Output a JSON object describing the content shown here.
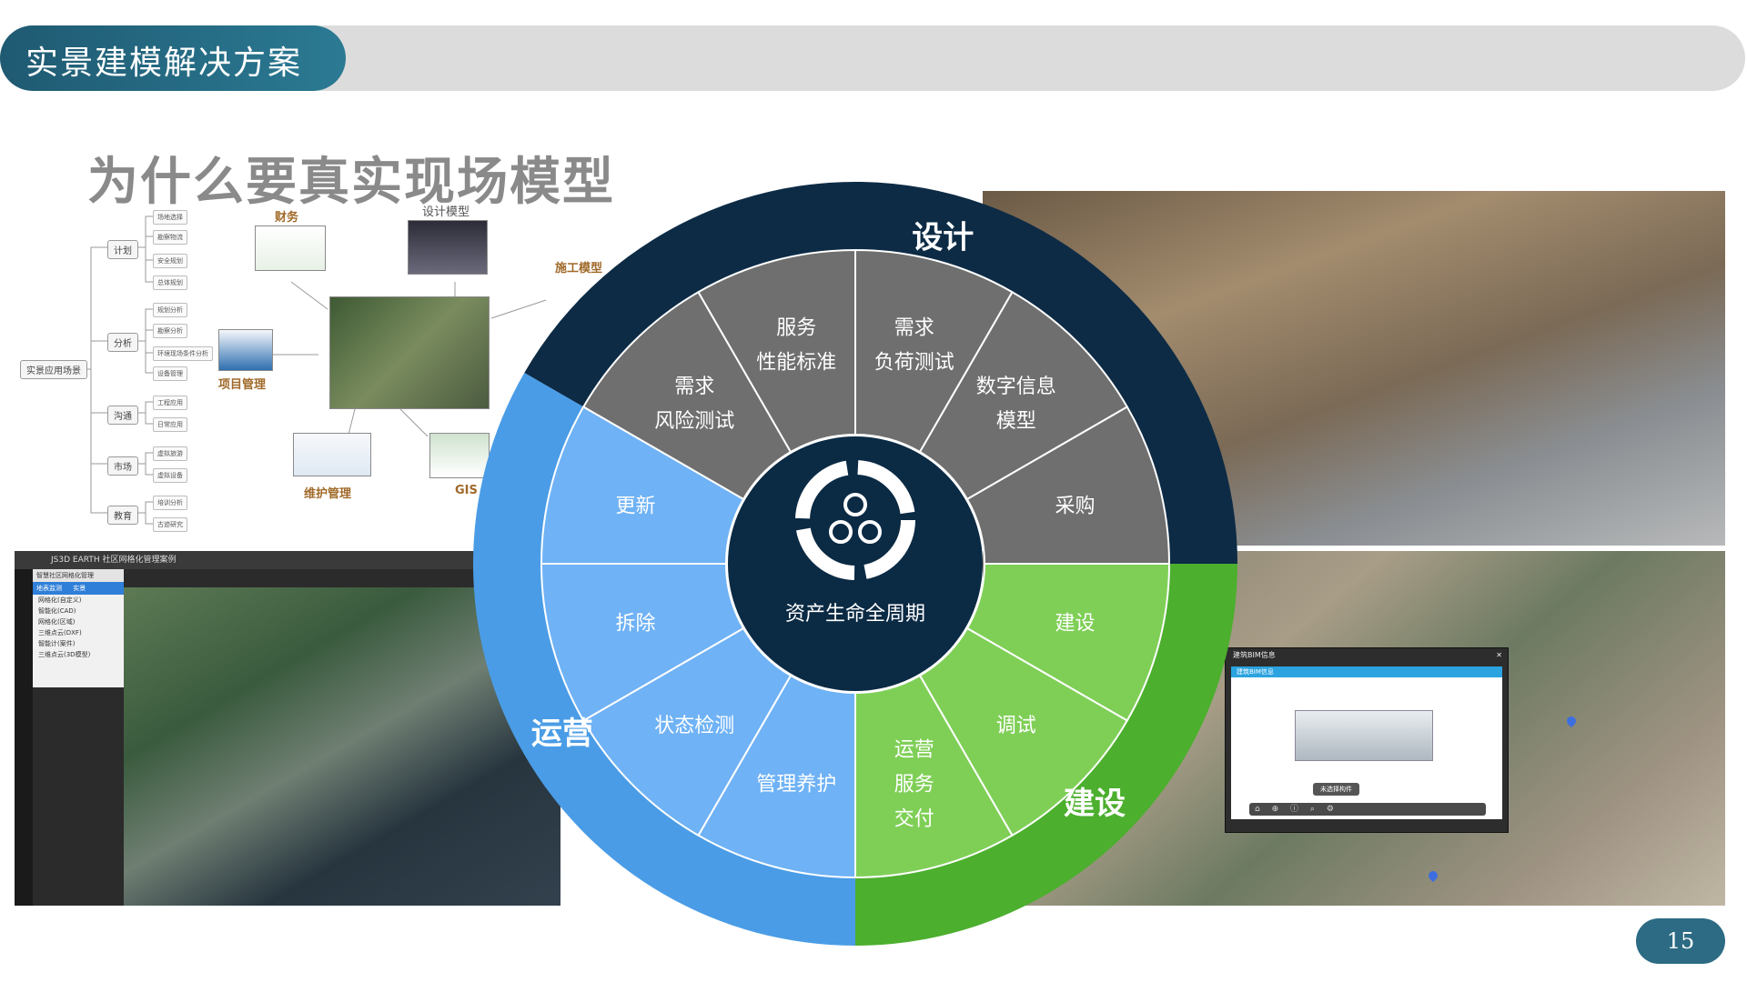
{
  "header": {
    "title": "实景建模解决方案"
  },
  "question": "为什么要真实现场模型",
  "page_number": "15",
  "mindmap": {
    "root": "实景应用场景",
    "branches": [
      {
        "label": "计划",
        "leaves": [
          "场地选择",
          "勘察物流",
          "安全规划",
          "总体规划"
        ]
      },
      {
        "label": "分析",
        "leaves": [
          "规划分析",
          "勘察分析",
          "环境现场条件分析",
          "设备管理"
        ]
      },
      {
        "label": "沟通",
        "leaves": [
          "工程应用",
          "日常应用"
        ]
      },
      {
        "label": "市场",
        "leaves": [
          "虚拟旅游",
          "虚拟设备"
        ]
      },
      {
        "label": "教育",
        "leaves": [
          "培训分析",
          "古迹研究"
        ]
      }
    ]
  },
  "captions": {
    "finance": "财务",
    "design_model": "设计模型",
    "construction_model": "施工模型",
    "project_mgmt": "项目管理",
    "maintenance_mgmt": "维护管理",
    "gis": "GIS"
  },
  "app_window": {
    "title": "JS3D EARTH  社区网格化管理案例",
    "subtitle": "智慧社区网格化管理",
    "tabs": [
      "地表监测",
      "实景"
    ],
    "layers": [
      "网格化(自定义)",
      "智能化(CAD)",
      "网格化(区域)",
      "三维点云(DXF)",
      "智能计(案件)",
      "三维点云(3D模型)"
    ]
  },
  "bim_popup": {
    "title": "建筑BIM信息",
    "subtitle": "建筑BIM信息",
    "status": "未选择构件"
  },
  "cycle": {
    "center_label": "资产生命全周期",
    "phases": [
      {
        "name": "设计",
        "color": "#0d2b45"
      },
      {
        "name": "建设",
        "color": "#4caf2e"
      },
      {
        "name": "运营",
        "color": "#4a9ce6"
      }
    ],
    "segments": [
      {
        "lines": [
          "需求",
          "风险测试"
        ],
        "phase": "设计"
      },
      {
        "lines": [
          "服务",
          "性能标准"
        ],
        "phase": "设计"
      },
      {
        "lines": [
          "需求",
          "负荷测试"
        ],
        "phase": "设计"
      },
      {
        "lines": [
          "数字信息",
          "模型"
        ],
        "phase": "设计"
      },
      {
        "lines": [
          "采购"
        ],
        "phase": "设计"
      },
      {
        "lines": [
          "建设"
        ],
        "phase": "建设"
      },
      {
        "lines": [
          "调试"
        ],
        "phase": "建设"
      },
      {
        "lines": [
          "运营",
          "服务",
          "交付"
        ],
        "phase": "建设"
      },
      {
        "lines": [
          "管理养护"
        ],
        "phase": "运营"
      },
      {
        "lines": [
          "状态检测"
        ],
        "phase": "运营"
      },
      {
        "lines": [
          "拆除"
        ],
        "phase": "运营"
      },
      {
        "lines": [
          "更新"
        ],
        "phase": "运营"
      }
    ],
    "colors": {
      "grey": "#6f6f6f",
      "green_light": "#7fcf57",
      "blue_light": "#6fb2f5",
      "center": "#0b2a44"
    }
  },
  "icons": [
    "cycle-logo-icon",
    "home-icon",
    "zoom-icon",
    "info-icon",
    "search-icon",
    "settings-icon",
    "close-icon",
    "map-pin-icon"
  ]
}
